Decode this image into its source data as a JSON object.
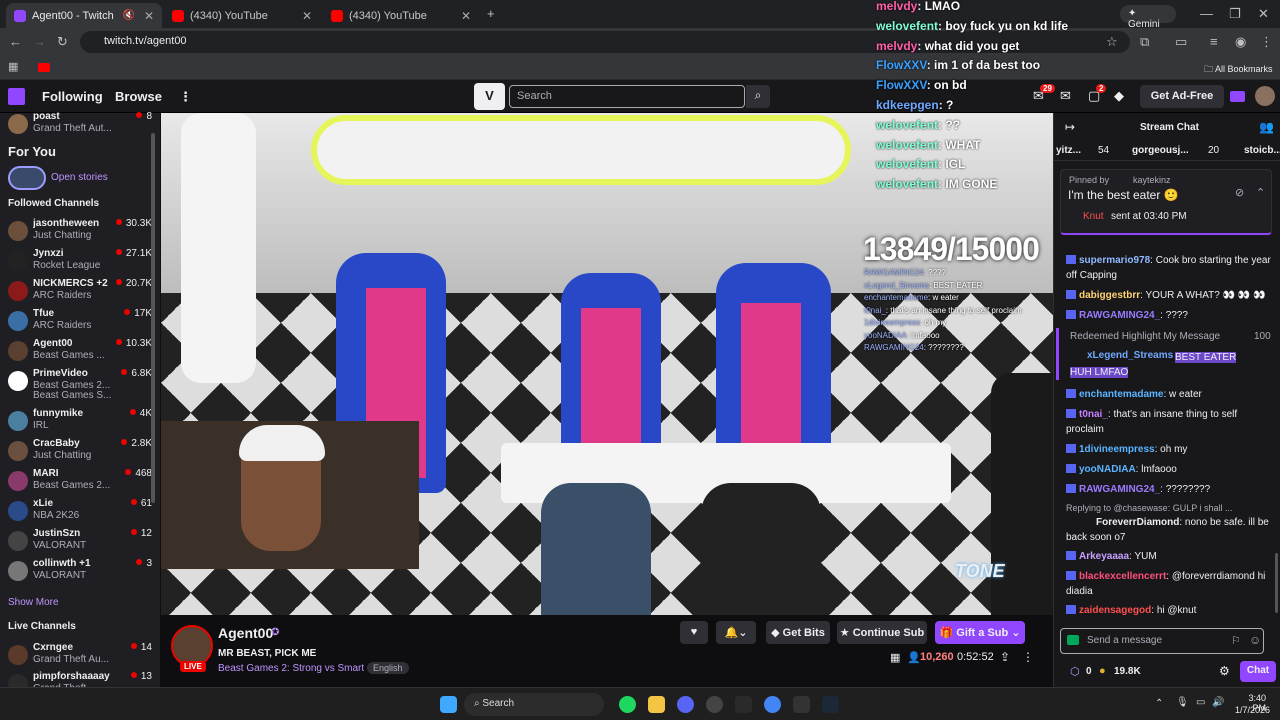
{
  "browser": {
    "tabs": [
      {
        "title": "Agent00 - Twitch",
        "color": "#9146ff"
      },
      {
        "title": "(4340) YouTube",
        "color": "#ff0000"
      },
      {
        "title": "(4340) YouTube",
        "color": "#ff0000"
      }
    ],
    "new_tab": "+",
    "gemini": "Gemini",
    "url": "twitch.tv/agent00",
    "bookmarks": "All Bookmarks"
  },
  "twitch_nav": {
    "following": "Following",
    "browse": "Browse",
    "search_placeholder": "Search",
    "notif_count": "29",
    "whisper_count": "2",
    "ad_free": "Get Ad-Free"
  },
  "sidebar": {
    "top_channel": {
      "name": "poast",
      "game": "Grand Theft Aut...",
      "viewers": "8"
    },
    "for_you": "For You",
    "open_stories": "Open stories",
    "followed_title": "Followed Channels",
    "followed": [
      {
        "name": "jasontheween",
        "game": "Just Chatting",
        "viewers": "30.3K",
        "color": "#6b4f3a"
      },
      {
        "name": "Jynxzi",
        "game": "Rocket League",
        "viewers": "27.1K",
        "color": "#222"
      },
      {
        "name": "NICKMERCS +2",
        "game": "ARC Raiders",
        "viewers": "20.7K",
        "color": "#8b1a1a"
      },
      {
        "name": "Tfue",
        "game": "ARC Raiders",
        "viewers": "17K",
        "color": "#3a6fa5"
      },
      {
        "name": "Agent00",
        "game": "Beast Games ...",
        "viewers": "10.3K",
        "color": "#5a4030"
      },
      {
        "name": "PrimeVideo",
        "game": "Beast Games 2...",
        "game2": "Beast Games S...",
        "viewers": "6.8K",
        "color": "#ffffff"
      },
      {
        "name": "funnymike",
        "game": "IRL",
        "viewers": "4K",
        "color": "#4a7fa0"
      },
      {
        "name": "CracBaby",
        "game": "Just Chatting",
        "viewers": "2.8K",
        "color": "#6b5040"
      },
      {
        "name": "MARI",
        "game": "Beast Games 2...",
        "viewers": "468",
        "color": "#8a3a6a"
      },
      {
        "name": "xLie",
        "game": "NBA 2K26",
        "viewers": "61",
        "color": "#2a4a8a"
      },
      {
        "name": "JustinSzn",
        "game": "VALORANT",
        "viewers": "12",
        "color": "#444"
      },
      {
        "name": "collinwth +1",
        "game": "VALORANT",
        "viewers": "3",
        "color": "#777"
      }
    ],
    "show_more": "Show More",
    "live_title": "Live Channels",
    "live": [
      {
        "name": "Cxrngee",
        "game": "Grand Theft Au...",
        "viewers": "14",
        "color": "#5a3a2a"
      },
      {
        "name": "pimpforshaaaay",
        "game": "Grand Theft...",
        "viewers": "13",
        "color": "#2a2a2a"
      }
    ]
  },
  "video_overlay": {
    "chat": [
      {
        "user": "melvdy",
        "msg": "LMAO",
        "color": "#ff5ea8"
      },
      {
        "user": "welovefent",
        "msg": "boy fuck yu on kd life",
        "color": "#7fffd4"
      },
      {
        "user": "melvdy",
        "msg": "what did you get",
        "color": "#ff5ea8"
      },
      {
        "user": "FlowXXV",
        "msg": "im 1 of da best too",
        "color": "#3aa0ff"
      },
      {
        "user": "FlowXXV",
        "msg": "on bd",
        "color": "#3aa0ff"
      },
      {
        "user": "kdkeepgen",
        "msg": "?",
        "color": "#6fa8ff"
      },
      {
        "user": "welovefent",
        "msg": "??",
        "color": "#7fffd4"
      },
      {
        "user": "welovefent",
        "msg": "WHAT",
        "color": "#7fffd4"
      },
      {
        "user": "welovefent",
        "msg": "IGL",
        "color": "#7fffd4"
      },
      {
        "user": "welovefent",
        "msg": "IM GONE",
        "color": "#7fffd4"
      }
    ],
    "counter": "13849/15000",
    "mini_chat": [
      {
        "user": "RAWGAMING24",
        "msg": "????"
      },
      {
        "user": "xLegend_Streams",
        "msg": "BEST EATER"
      },
      {
        "user": "enchantemadame",
        "msg": "w eater"
      },
      {
        "user": "t0nai_",
        "msg": "that's an insane thing to self proclaim"
      },
      {
        "user": "1divineempress",
        "msg": "oh my"
      },
      {
        "user": "yooNADIAA",
        "msg": "lmfaooo"
      },
      {
        "user": "RAWGAMING24",
        "msg": "????????"
      }
    ],
    "watermark": "TONE"
  },
  "stream_info": {
    "channel": "Agent00",
    "title": "MR BEAST, PICK ME",
    "game": "Beast Games 2: Strong vs Smart",
    "tag": "English",
    "live": "LIVE",
    "viewers": "10,260",
    "uptime": "0:52:52",
    "get_bits": "Get Bits",
    "continue_sub": "Continue Sub",
    "gift_sub": "Gift a Sub"
  },
  "chat": {
    "title": "Stream Chat",
    "top_gifters": [
      {
        "name": "yitz...",
        "count": "54"
      },
      {
        "name": "gorgeousj...",
        "count": "20"
      },
      {
        "name": "stoicb..."
      }
    ],
    "pinned_by_label": "Pinned by",
    "pinned_by": "kaytekinz",
    "pinned_msg": "I'm the best eater 🙂",
    "pinned_user": "Knut",
    "pinned_time": "sent at 03:40 PM",
    "messages": [
      {
        "user": "supermario978",
        "msg": "Cook bro starting the year off Capping",
        "color": "#8fbaff"
      },
      {
        "user": "dabiggestbrr",
        "msg": "YOUR A WHAT? 👀 👀 👀",
        "color": "#ffd36f"
      },
      {
        "user": "RAWGAMING24_",
        "msg": "????",
        "color": "#9b7bff"
      }
    ],
    "redeem": {
      "label": "Redeemed Highlight My Message",
      "cost": "100",
      "user": "xLegend_Streams",
      "msg": "BEST EATER HUH LMFAO"
    },
    "messages2": [
      {
        "user": "enchantemadame",
        "msg": "w eater",
        "color": "#5ab4ff"
      },
      {
        "user": "t0nai_",
        "msg": "that's an insane thing to self proclaim",
        "color": "#c77dff"
      },
      {
        "user": "1divineempress",
        "msg": "oh my",
        "color": "#5ab4ff"
      },
      {
        "user": "yooNADIAA",
        "msg": "lmfaooo",
        "color": "#5ab4ff"
      },
      {
        "user": "RAWGAMING24_",
        "msg": "????????",
        "color": "#9b7bff"
      }
    ],
    "reply_to": "Replying to @chasewase: GULP i shall ...",
    "reply": {
      "user": "ForeverrDiamond",
      "msg": "nono be safe. ill be back soon o7",
      "color": "#ff66c4"
    },
    "messages3": [
      {
        "user": "Arkeyaaaa",
        "msg": "YUM",
        "color": "#c9a0ff"
      },
      {
        "user": "blackexcellencerrt",
        "msg": "@foreverrdiamond hi diadia",
        "color": "#ff4f7a"
      },
      {
        "user": "zaidensagegod",
        "msg": "hi @knut",
        "color": "#ff4f4f"
      }
    ],
    "input_placeholder": "Send a message",
    "points": "0",
    "bits": "19.8K",
    "chat_button": "Chat"
  },
  "taskbar": {
    "search": "Search",
    "time": "3:40 PM",
    "date": "1/7/2026"
  }
}
